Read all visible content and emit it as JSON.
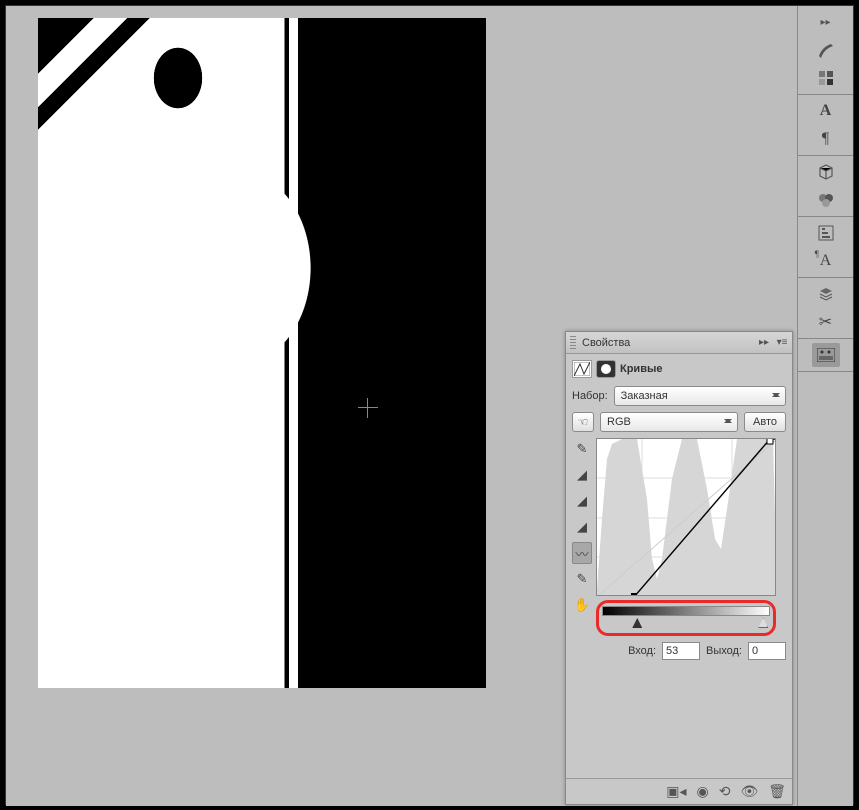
{
  "panel": {
    "tab_label": "Свойства",
    "title": "Кривые",
    "preset_label": "Набор:",
    "preset_value": "Заказная",
    "channel_value": "RGB",
    "auto_label": "Авто",
    "input_label": "Вход:",
    "output_label": "Выход:",
    "input_value": "53",
    "output_value": "0"
  },
  "right_tools": {
    "group1": [
      "brush-icon",
      "swatches-icon"
    ],
    "group2": [
      "A",
      "¶"
    ],
    "group3": [
      "cube-icon",
      "materials-icon"
    ],
    "group4": [
      "adjust-icon",
      "char-A-icon"
    ],
    "group5": [
      "layers-icon",
      "tools-icon"
    ],
    "active": "properties-icon"
  },
  "curve_tools": [
    "sample",
    "eyedrop-black",
    "eyedrop-gray",
    "eyedrop-white",
    "curve",
    "pencil",
    "hand"
  ],
  "curve_tool_active": "curve",
  "chart_data": {
    "type": "line",
    "title": "",
    "xlabel": "Вход",
    "ylabel": "Выход",
    "xlim": [
      0,
      255
    ],
    "ylim": [
      0,
      255
    ],
    "series": [
      {
        "name": "curve",
        "x": [
          0,
          53,
          245,
          255
        ],
        "y": [
          0,
          0,
          255,
          255
        ]
      }
    ],
    "histogram": [
      0,
      0,
      10,
      30,
      60,
      120,
      200,
      240,
      255,
      255,
      255,
      220,
      150,
      80,
      40,
      20,
      40,
      80,
      140,
      255,
      255,
      255,
      255,
      255,
      180,
      110,
      70,
      60,
      130,
      200,
      255,
      255,
      255,
      240,
      255,
      255,
      255,
      255,
      200,
      100,
      30,
      5,
      0,
      0,
      0,
      0,
      0,
      0,
      0,
      0,
      0,
      0,
      0,
      0,
      0,
      0,
      0,
      0,
      0,
      0,
      0,
      0,
      0,
      0
    ]
  }
}
